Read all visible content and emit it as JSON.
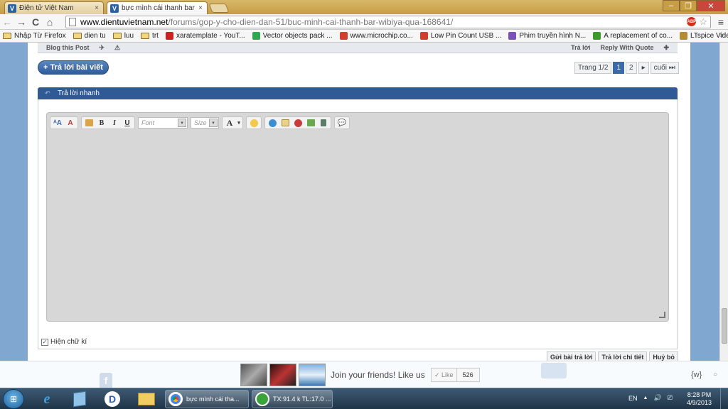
{
  "tabs": [
    {
      "favicon": "V",
      "label": "Điện tử Việt Nam",
      "close": "×"
    },
    {
      "favicon": "V",
      "label": "bực mình cái thanh bar W",
      "close": "×"
    }
  ],
  "window_buttons": {
    "minimize": "–",
    "maximize": "❐",
    "close": "✕"
  },
  "nav": {
    "back": "←",
    "forward": "→",
    "reload": "C",
    "home": "⌂"
  },
  "address": {
    "host": "www.dientuvietnam.net",
    "path": "/forums/gop-y-cho-dien-dan-51/buc-minh-cai-thanh-bar-wibiya-qua-168641/",
    "abp": "ABP",
    "star": "☆",
    "menu": "≡"
  },
  "bookmarks": [
    {
      "type": "folder",
      "label": "Nhập Từ Firefox"
    },
    {
      "type": "folder",
      "label": "dien tu"
    },
    {
      "type": "folder",
      "label": "luu"
    },
    {
      "type": "folder",
      "label": "trt"
    },
    {
      "type": "site",
      "color": "#cc2222",
      "label": "xaratemplate - YouT..."
    },
    {
      "type": "site",
      "color": "#2fa84f",
      "label": "Vector objects pack ..."
    },
    {
      "type": "site",
      "color": "#d23d2e",
      "label": "www.microchip.co..."
    },
    {
      "type": "site",
      "color": "#d23d2e",
      "label": "Low Pin Count USB ..."
    },
    {
      "type": "site",
      "color": "#7b4fb8",
      "label": "Phim truyền hình N..."
    },
    {
      "type": "site",
      "color": "#3a9a2a",
      "label": "A replacement of co..."
    },
    {
      "type": "site",
      "color": "#b48a32",
      "label": "LTspice Video Tutori..."
    }
  ],
  "bookmarks_more": "»",
  "postbar": {
    "blog": "Blog this Post",
    "reply": "Trả lời",
    "quote": "Reply With Quote"
  },
  "reply_button": "+ Trả lời bài viết",
  "pager": {
    "label": "Trang 1/2",
    "pages": [
      "1",
      "2"
    ],
    "next": "▸",
    "last": "cuối ⏭"
  },
  "quick_reply": {
    "title": "Trả lời nhanh"
  },
  "editor": {
    "font_placeholder": "Font",
    "size_placeholder": "Size",
    "bold": "B",
    "italic": "I",
    "underline": "U",
    "color": "A",
    "dd": "▾"
  },
  "signature": {
    "checked": "✓",
    "label": "Hiện chữ kí"
  },
  "actions": [
    "Gửi bài trả lời",
    "Trả lời chi tiết",
    "Huỷ bỏ"
  ],
  "social": {
    "join": "Join your friends! Like us",
    "like_label": "✓ Like",
    "like_count": "526",
    "fw": "{w}",
    "circle": "○",
    "fb": "f"
  },
  "taskbar": {
    "start": "⊞",
    "tasks": [
      {
        "label": "bực mình cái tha..."
      },
      {
        "label": "TX:91.4 k TL:17.0 ..."
      }
    ],
    "lang": "EN",
    "tray": [
      "▲",
      "🔊",
      "⎚"
    ],
    "time": "8:28 PM",
    "date": "4/9/2013"
  }
}
